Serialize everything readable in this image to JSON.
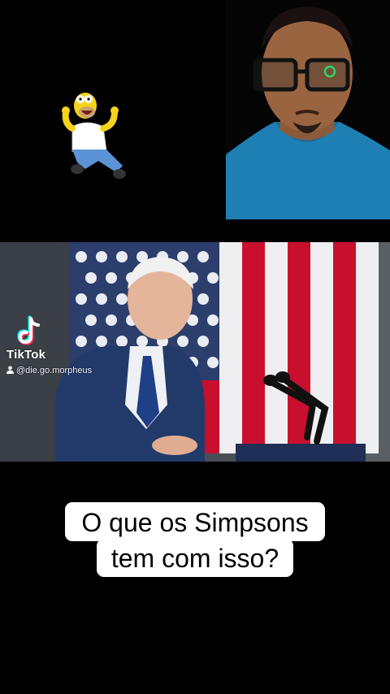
{
  "watermark": {
    "brand": "TikTok",
    "handle": "@die.go.morpheus"
  },
  "caption": {
    "line1": "O que os Simpsons",
    "line2": "tem com isso?"
  },
  "colors": {
    "background": "#000000",
    "caption_background": "#ffffff",
    "caption_text": "#000000",
    "flag_red": "#c8102e",
    "flag_blue": "#2c3e6b",
    "tiktok_cyan": "#25f4ee",
    "tiktok_pink": "#fe2c55"
  },
  "icons": {
    "tiktok_logo": "tiktok-logo-icon",
    "user": "user-icon"
  }
}
